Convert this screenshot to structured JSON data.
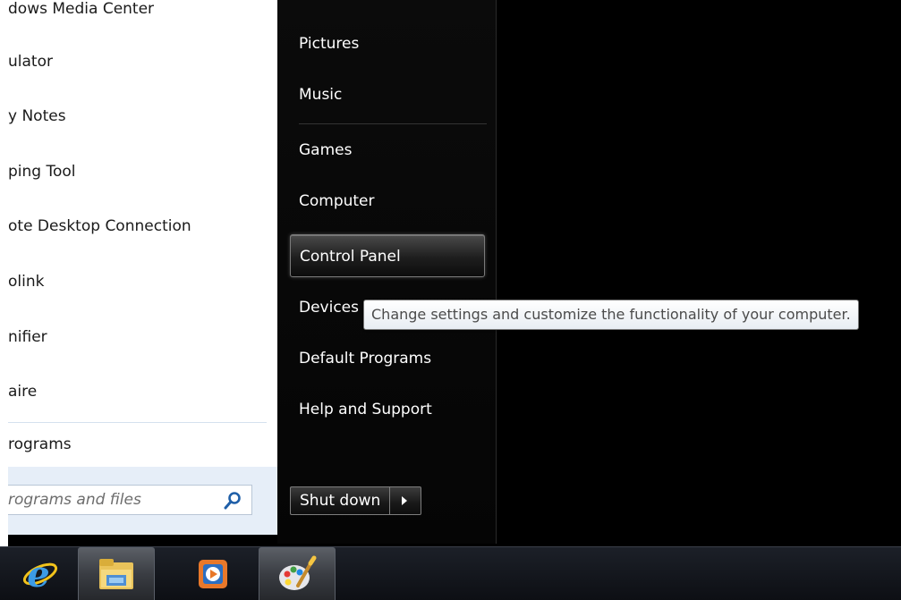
{
  "start_menu": {
    "programs": [
      {
        "label": "dows Media Center"
      },
      {
        "label": "ulator"
      },
      {
        "label": "y Notes"
      },
      {
        "label": "ping Tool"
      },
      {
        "label": "ote Desktop Connection"
      },
      {
        "label": "olink"
      },
      {
        "label": "nifier"
      },
      {
        "label": "aire"
      }
    ],
    "all_programs_label": "rograms",
    "search": {
      "placeholder": "rograms and files",
      "value": ""
    },
    "right_items": [
      {
        "label": "Pictures"
      },
      {
        "label": "Music"
      },
      {
        "label": "Games"
      },
      {
        "label": "Computer"
      },
      {
        "label": "Control Panel"
      },
      {
        "label": "Devices"
      },
      {
        "label": "Default Programs"
      },
      {
        "label": "Help and Support"
      }
    ],
    "shutdown_label": "Shut down",
    "tooltip": "Change settings and customize the functionality of your computer."
  },
  "taskbar": {
    "items": [
      {
        "icon": "internet-explorer-icon"
      },
      {
        "icon": "windows-explorer-icon"
      },
      {
        "icon": "media-player-icon"
      },
      {
        "icon": "paint-icon"
      }
    ]
  },
  "colors": {
    "tooltip_border": "#767676",
    "menu_right_bg": "#0b0b0b",
    "search_row_bg": "#e6eef8"
  }
}
